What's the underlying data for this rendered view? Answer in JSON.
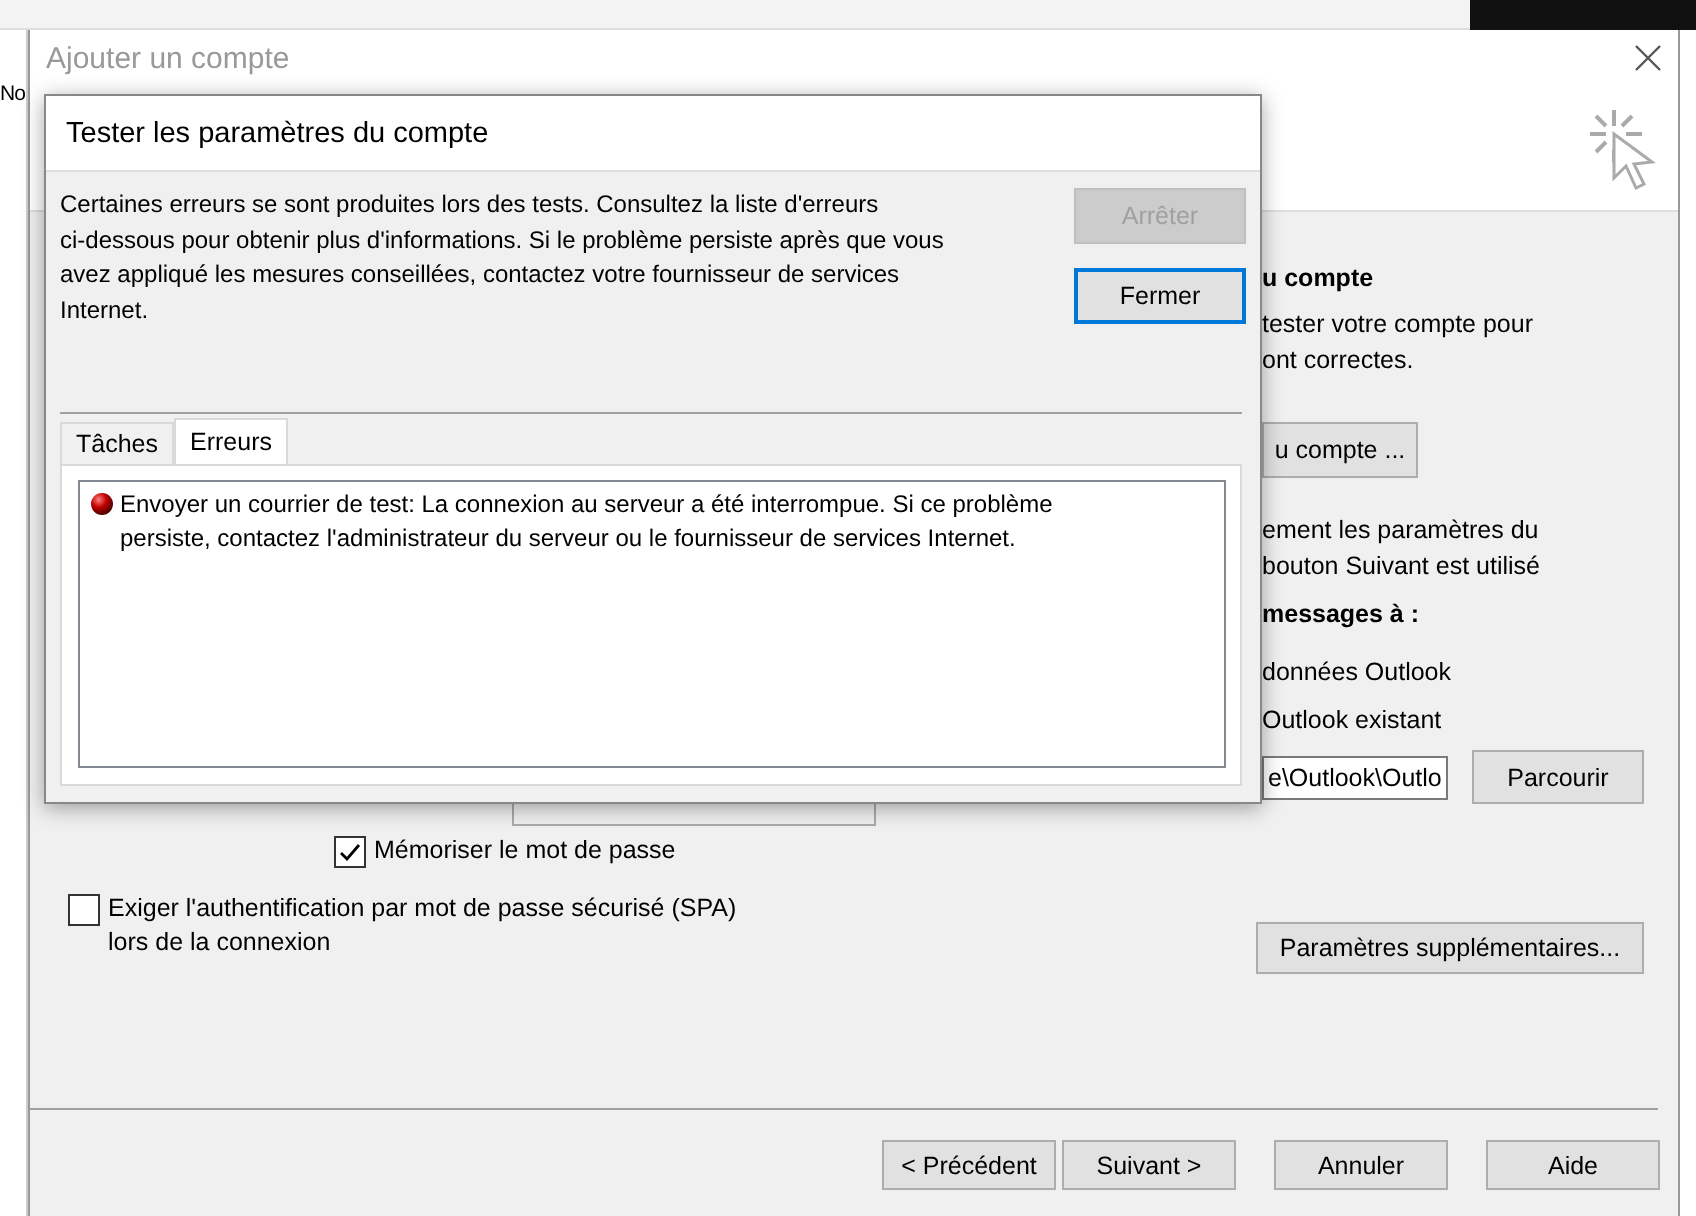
{
  "background_app": {
    "menu_fragment": "No"
  },
  "window": {
    "title": "Ajouter un compte"
  },
  "right_panel": {
    "heading": "u compte",
    "intro": "tester votre compte pour\nont correctes.",
    "test_button": "u compte ...",
    "note": "ement les paramètres du\nbouton Suivant est utilisé",
    "deliver_heading": "messages à :",
    "option_1": "données Outlook",
    "option_2": "Outlook existant",
    "path_field": "e\\Outlook\\Outlo",
    "browse_button": "Parcourir"
  },
  "checkboxes": [
    {
      "label": "Mémoriser le mot de passe",
      "checked": true
    },
    {
      "label": "Exiger l'authentification par mot de passe sécurisé (SPA)\nlors de la connexion",
      "checked": false
    }
  ],
  "more_settings_button": "Paramètres supplémentaires...",
  "footer_buttons": [
    {
      "label": "< Précédent"
    },
    {
      "label": "Suivant >"
    },
    {
      "label": "Annuler"
    },
    {
      "label": "Aide"
    }
  ],
  "test_dialog": {
    "title": "Tester les paramètres du compte",
    "message": "Certaines erreurs se sont produites lors des tests. Consultez la liste d'erreurs\nci-dessous pour obtenir plus d'informations. Si le problème persiste après que vous\navez appliqué les mesures conseillées, contactez votre fournisseur de services\nInternet.",
    "buttons": [
      {
        "label": "Arrêter",
        "disabled": true,
        "default": false
      },
      {
        "label": "Fermer",
        "disabled": false,
        "default": true
      }
    ],
    "tabs": [
      {
        "label": "Tâches",
        "selected": false
      },
      {
        "label": "Erreurs",
        "selected": true
      }
    ],
    "errors": [
      "Envoyer un courrier de test: La connexion au serveur a été interrompue. Si ce problème\npersiste, contactez l'administrateur du serveur ou le fournisseur de services Internet."
    ]
  }
}
